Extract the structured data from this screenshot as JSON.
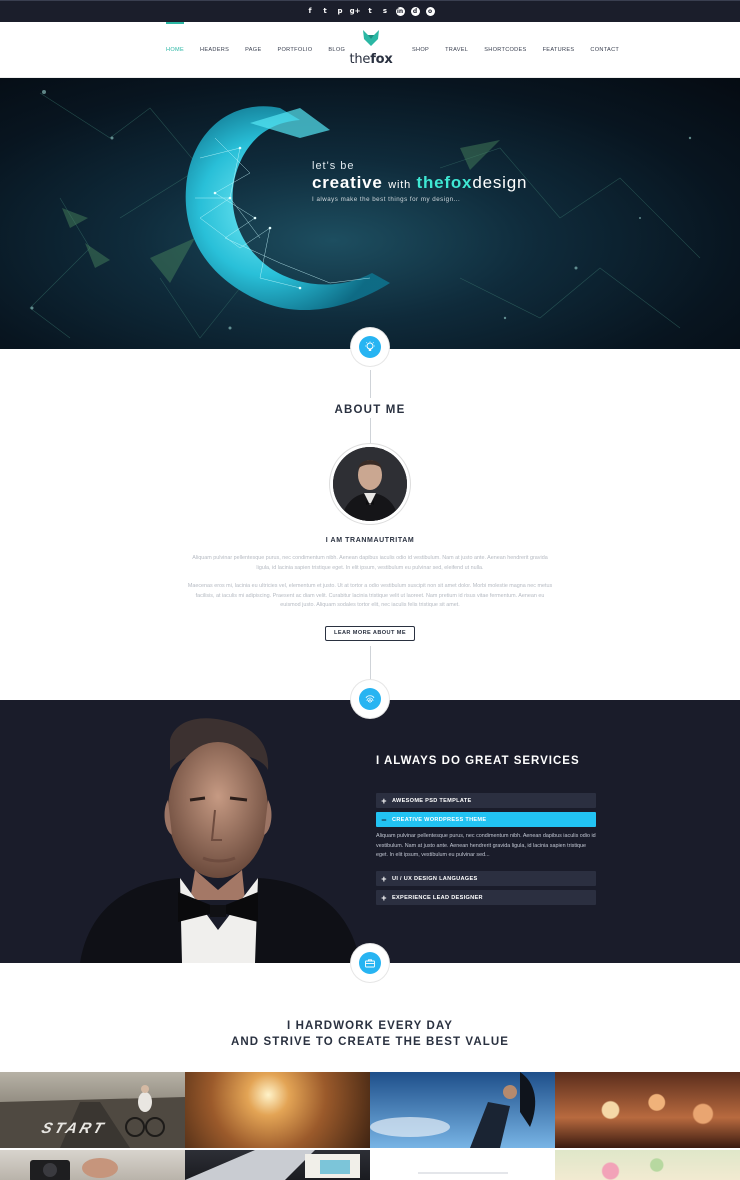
{
  "social": {
    "icons": [
      "f",
      "t",
      "p",
      "g+",
      "t",
      "s",
      "in",
      "d",
      "o"
    ]
  },
  "nav": {
    "left": [
      "HOME",
      "HEADERS",
      "PAGE",
      "PORTFOLIO",
      "BLOG"
    ],
    "right": [
      "SHOP",
      "TRAVEL",
      "SHORTCODES",
      "FEATURES",
      "CONTACT"
    ],
    "active": "HOME"
  },
  "logo": {
    "part1": "the",
    "part2": "fox"
  },
  "hero": {
    "line1": "let's be",
    "creative": "creative",
    "with": "with",
    "accent": "thefox",
    "design": "design",
    "tagline": "I always make the best things for my design..."
  },
  "about": {
    "title": "ABOUT ME",
    "name": "I AM TRANMAUTRITAM",
    "para1": "Aliquam pulvinar pellentesque purus, nec condimentum nibh. Aenean dapibus iaculis odio id vestibulum. Nam at justo ante. Aenean hendrerit gravida ligula, id lacinia sapien tristique eget. In elit ipsum, vestibulum eu pulvinar sed, eleifend ut nulla.",
    "para2": "Maecenas eros mi, lacinia eu ultricies vel, elementum et justo. Ut at tortor a odio vestibulum suscipit non sit amet dolor. Morbi molestie magna nec metus facilisis, at iaculis mi adipiscing. Praesent ac diam velit. Curabitur lacinia tristique velit ut laoreet. Nam pretium id risus vitae fermentum. Aenean eu euismod justo. Aliquam sodales tortor elit, nec iaculis felis tristique sit amet.",
    "button": "LEAR MORE ABOUT ME"
  },
  "services": {
    "title": "I ALWAYS DO GREAT SERVICES",
    "items": [
      {
        "label": "AWESOME PSD TEMPLATE",
        "open": false
      },
      {
        "label": "CREATIVE WORDPRESS THEME",
        "open": true
      },
      {
        "label": "UI / UX DESIGN LANGUAGES",
        "open": false
      },
      {
        "label": "EXPERIENCE LEAD DESIGNER",
        "open": false
      }
    ],
    "open_body": "Aliquam pulvinar pellentesque purus, nec condimentum nibh. Aenean dapibus iaculis odio id vestibulum. Nam at justo ante. Aenean hendrerit gravida ligula, id lacinia sapien tristique eget. In elit ipsum, vestibulum eu pulvinar sed..."
  },
  "hardwork": {
    "line1": "I  HARDWORK EVERY DAY",
    "line2": "AND STRIVE TO CREATE THE BEST VALUE"
  },
  "gallery": {
    "start_text": "START"
  },
  "colors": {
    "accent_teal": "#2bb7a4",
    "accent_blue": "#27b4f2",
    "dark": "#1a1c2a"
  }
}
